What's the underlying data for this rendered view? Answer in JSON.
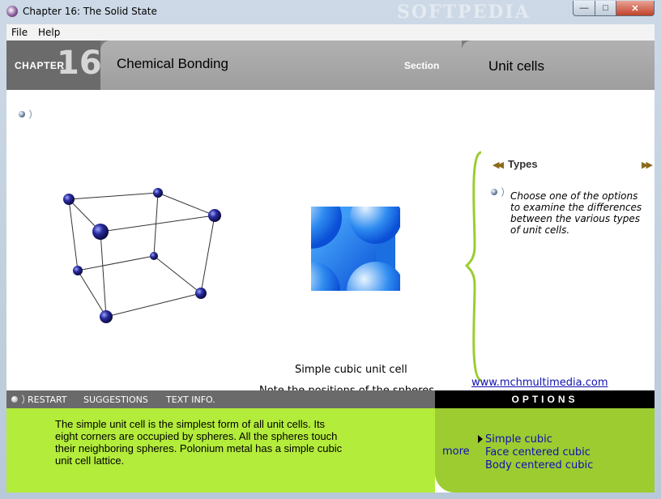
{
  "window": {
    "title": "Chapter 16: The Solid State",
    "watermark": "SOFTPEDIA"
  },
  "menu": {
    "file": "File",
    "help": "Help"
  },
  "header": {
    "chapter_label": "CHAPTER",
    "chapter_number": "16",
    "chapter_title": "Chemical Bonding",
    "section_label": "Section",
    "section_title": "Unit cells"
  },
  "main": {
    "caption_title": "Simple cubic unit cell",
    "caption_note": "Note the positions of the spheres."
  },
  "sidebar": {
    "title": "Types",
    "description": "Choose one of the options to examine the differences between the various types of unit cells.",
    "website": "www.mchmultimedia.com"
  },
  "toolbar": {
    "restart": "RESTART",
    "suggestions": "SUGGESTIONS",
    "text_info": "TEXT INFO."
  },
  "options": {
    "title": "OPTIONS",
    "more": "more",
    "items": [
      {
        "label": "Simple cubic",
        "selected": true
      },
      {
        "label": "Face centered cubic",
        "selected": false
      },
      {
        "label": "Body centered cubic",
        "selected": false
      }
    ]
  },
  "description": "The simple unit cell is the simplest form of all unit cells. Its eight corners are occupied by spheres.  All the spheres touch their neighboring spheres. Polonium metal has a simple cubic unit cell lattice.",
  "colors": {
    "header_gray": "#7c7c7c",
    "panel_green": "#b3ec3a",
    "options_green": "#9ccc30",
    "link_blue": "#1010b0",
    "sphere_blue": "#2a2a9e",
    "cube_blue": "#1a7ae8"
  },
  "icons": {
    "app": "app-icon",
    "speaker": "speaker-icon",
    "prev": "double-left-arrow-icon",
    "next": "double-right-arrow-icon"
  }
}
